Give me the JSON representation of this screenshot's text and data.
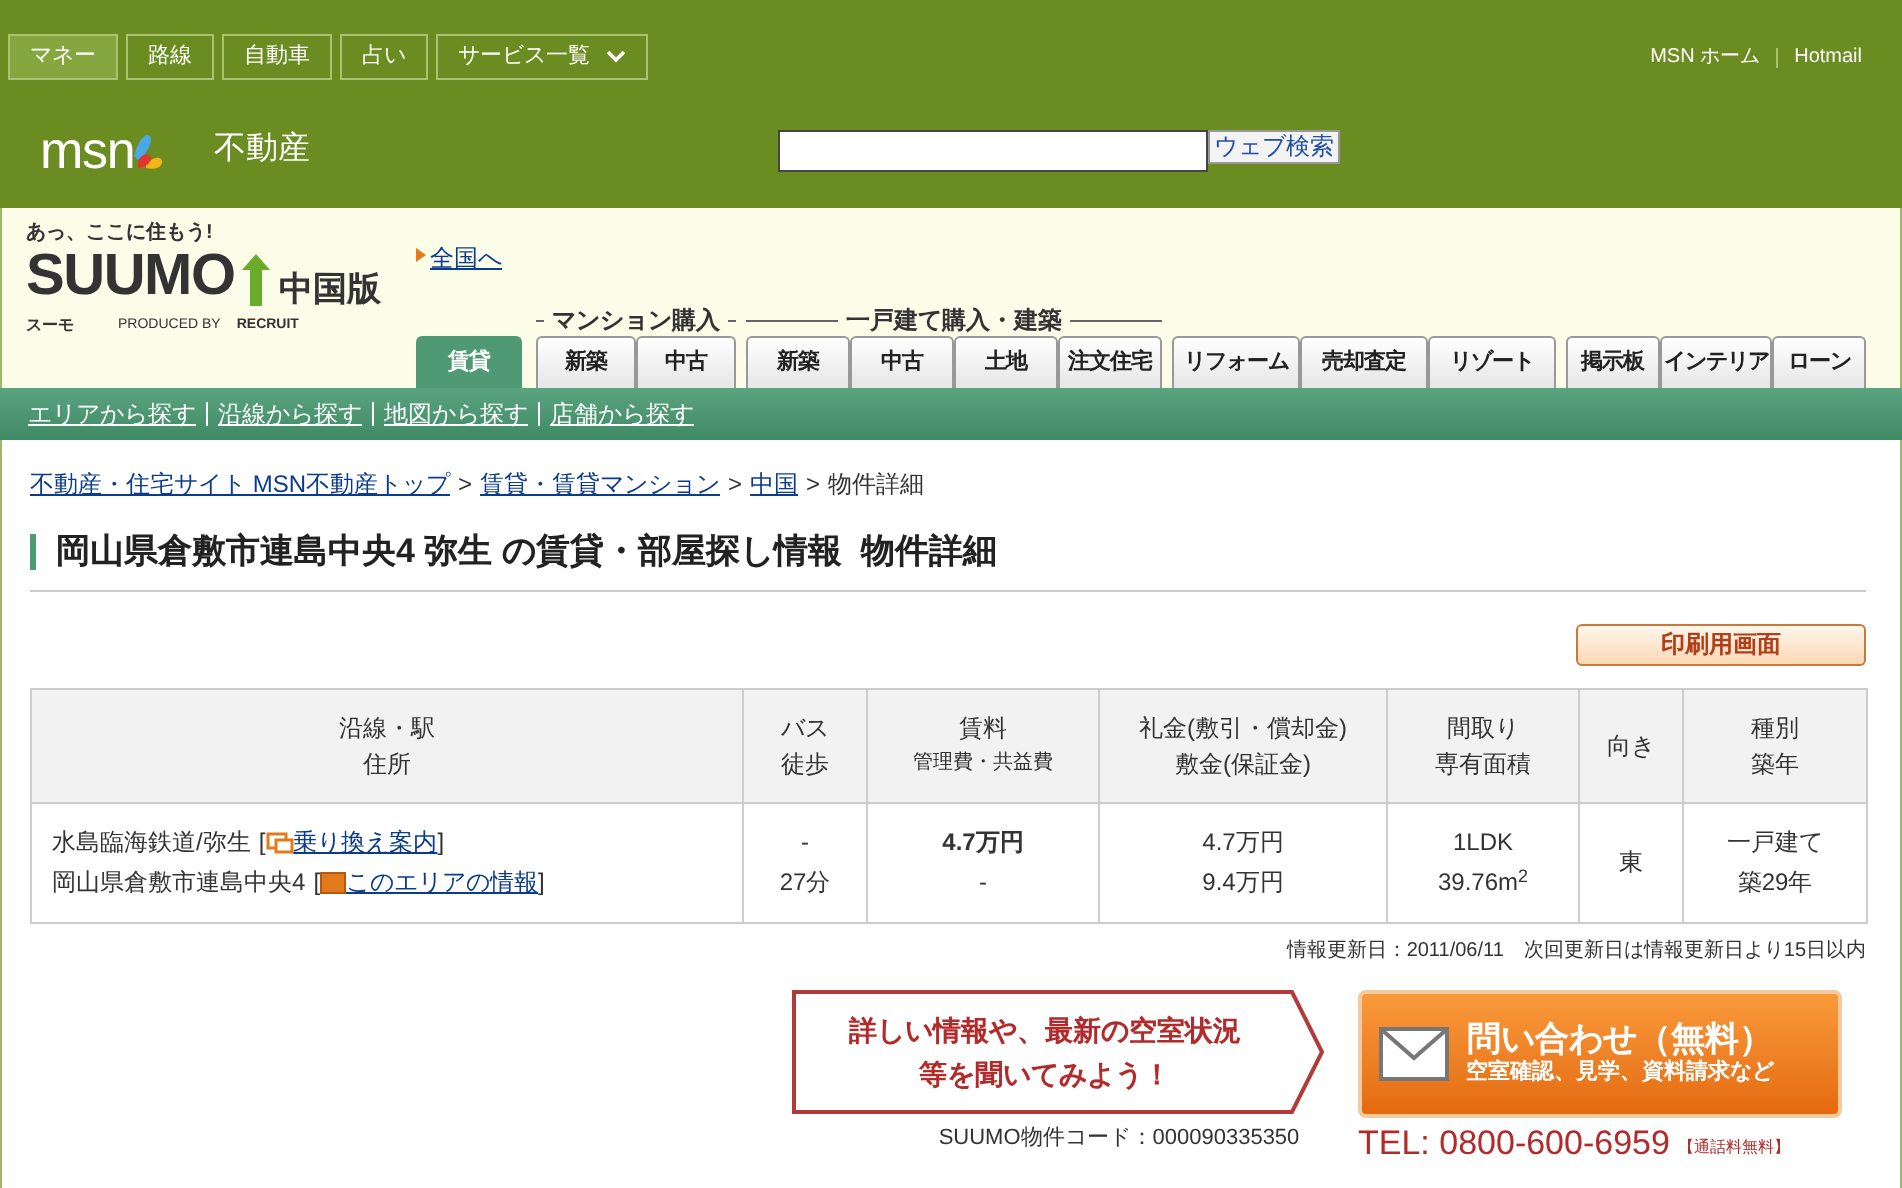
{
  "top_nav": {
    "items": [
      {
        "label": "マネー",
        "selected": true,
        "kind": "link"
      },
      {
        "label": "路線",
        "selected": false,
        "kind": "link"
      },
      {
        "label": "自動車",
        "selected": false,
        "kind": "link"
      },
      {
        "label": "占い",
        "selected": false,
        "kind": "link"
      },
      {
        "label": "サービス一覧",
        "selected": false,
        "kind": "dropdown"
      }
    ],
    "right_links": [
      "MSN ホーム",
      "Hotmail"
    ]
  },
  "msn_header": {
    "logo": "msn",
    "section": "不動産",
    "search_button": "ウェブ検索"
  },
  "suumo_header": {
    "tagline": "あっ、ここに住もう!",
    "logo": "SUUMO",
    "kana": "スーモ",
    "produced_by": "PRODUCED BY",
    "recruit": "RECRUIT",
    "region": "中国版",
    "nationwide_link": "全国へ"
  },
  "tab_groups": [
    {
      "tabs": [
        {
          "label": "賃貸",
          "selected": true
        }
      ]
    },
    {
      "label": "マンション購入",
      "tabs": [
        {
          "label": "新築",
          "selected": false
        },
        {
          "label": "中古",
          "selected": false
        }
      ]
    },
    {
      "label": "一戸建て購入・建築",
      "tabs": [
        {
          "label": "新築",
          "selected": false
        },
        {
          "label": "中古",
          "selected": false
        },
        {
          "label": "土地",
          "selected": false
        },
        {
          "label": "注文住宅",
          "selected": false
        }
      ]
    },
    {
      "tabs": [
        {
          "label": "リフォーム",
          "selected": false
        },
        {
          "label": "売却査定",
          "selected": false
        },
        {
          "label": "リゾート",
          "selected": false
        }
      ]
    },
    {
      "tabs": [
        {
          "label": "掲示板",
          "selected": false
        },
        {
          "label": "インテリア",
          "selected": false
        },
        {
          "label": "ローン",
          "selected": false
        }
      ]
    }
  ],
  "sub_nav": [
    "エリアから探す",
    "沿線から探す",
    "地図から探す",
    "店舗から探す"
  ],
  "breadcrumb": {
    "separator": ">",
    "links": [
      "不動産・住宅サイト MSN不動産トップ",
      "賃貸・賃貸マンション",
      "中国"
    ],
    "current": "物件詳細"
  },
  "page_title": "岡山県倉敷市連島中央4 弥生 の賃貸・部屋探し情報  物件詳細",
  "print_button": "印刷用画面",
  "table": {
    "columns": [
      [
        "沿線・駅",
        "住所"
      ],
      [
        "バス",
        "徒歩"
      ],
      [
        "賃料",
        "管理費・共益費"
      ],
      [
        "礼金(敷引・償却金)",
        "敷金(保証金)"
      ],
      [
        "間取り",
        "専有面積"
      ],
      [
        "向き"
      ],
      [
        "種別",
        "築年"
      ]
    ],
    "row": {
      "bracket_open": "[",
      "bracket_close": "]",
      "station": "水島臨海鉄道/弥生",
      "transfer_link": "乗り換え案内",
      "address": "岡山県倉敷市連島中央4",
      "area_link": "このエリアの情報",
      "bus": "-",
      "walk": "27分",
      "rent": "4.7万円",
      "fee": "-",
      "key_money": "4.7万円",
      "deposit": "9.4万円",
      "layout": "1LDK",
      "area": "39.76m$^{2}$",
      "facing": "東",
      "type": "一戸建て",
      "age": "築29年"
    }
  },
  "update_info": "情報更新日：2011/06/11　次回更新日は情報更新日より15日以内",
  "callout": [
    "詳しい情報や、最新の空室状況",
    "等を聞いてみよう！"
  ],
  "property_code": "SUUMO物件コード：000090335350",
  "inquiry_button": {
    "title": "問い合わせ（無料）",
    "subtitle": "空室確認、見学、資料請求など"
  },
  "tel": {
    "number": "TEL: 0800-600-6959",
    "note": "【通話料無料】"
  }
}
